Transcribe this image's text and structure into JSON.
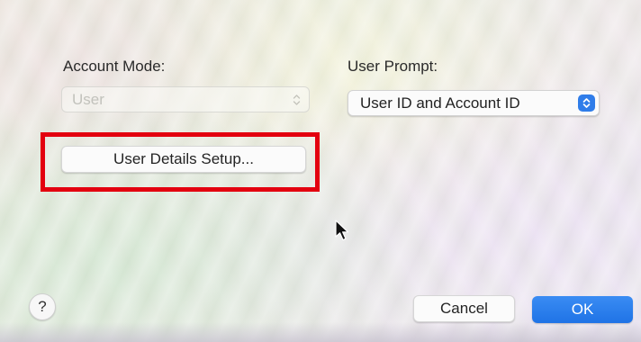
{
  "account_mode": {
    "label": "Account Mode:",
    "selected": "User",
    "enabled": false
  },
  "user_prompt": {
    "label": "User Prompt:",
    "selected": "User ID and Account ID",
    "enabled": true
  },
  "user_details_button": {
    "label": "User Details Setup..."
  },
  "help_button": {
    "label": "?"
  },
  "cancel_button": {
    "label": "Cancel"
  },
  "ok_button": {
    "label": "OK"
  },
  "colors": {
    "accent": "#2F7DE9",
    "highlight_box": "#E3000F"
  },
  "icons": {
    "account_mode_chevron": "up-down-chevron-icon",
    "user_prompt_chevron": "up-down-chevron-icon",
    "pointer": "mouse-pointer-icon"
  }
}
